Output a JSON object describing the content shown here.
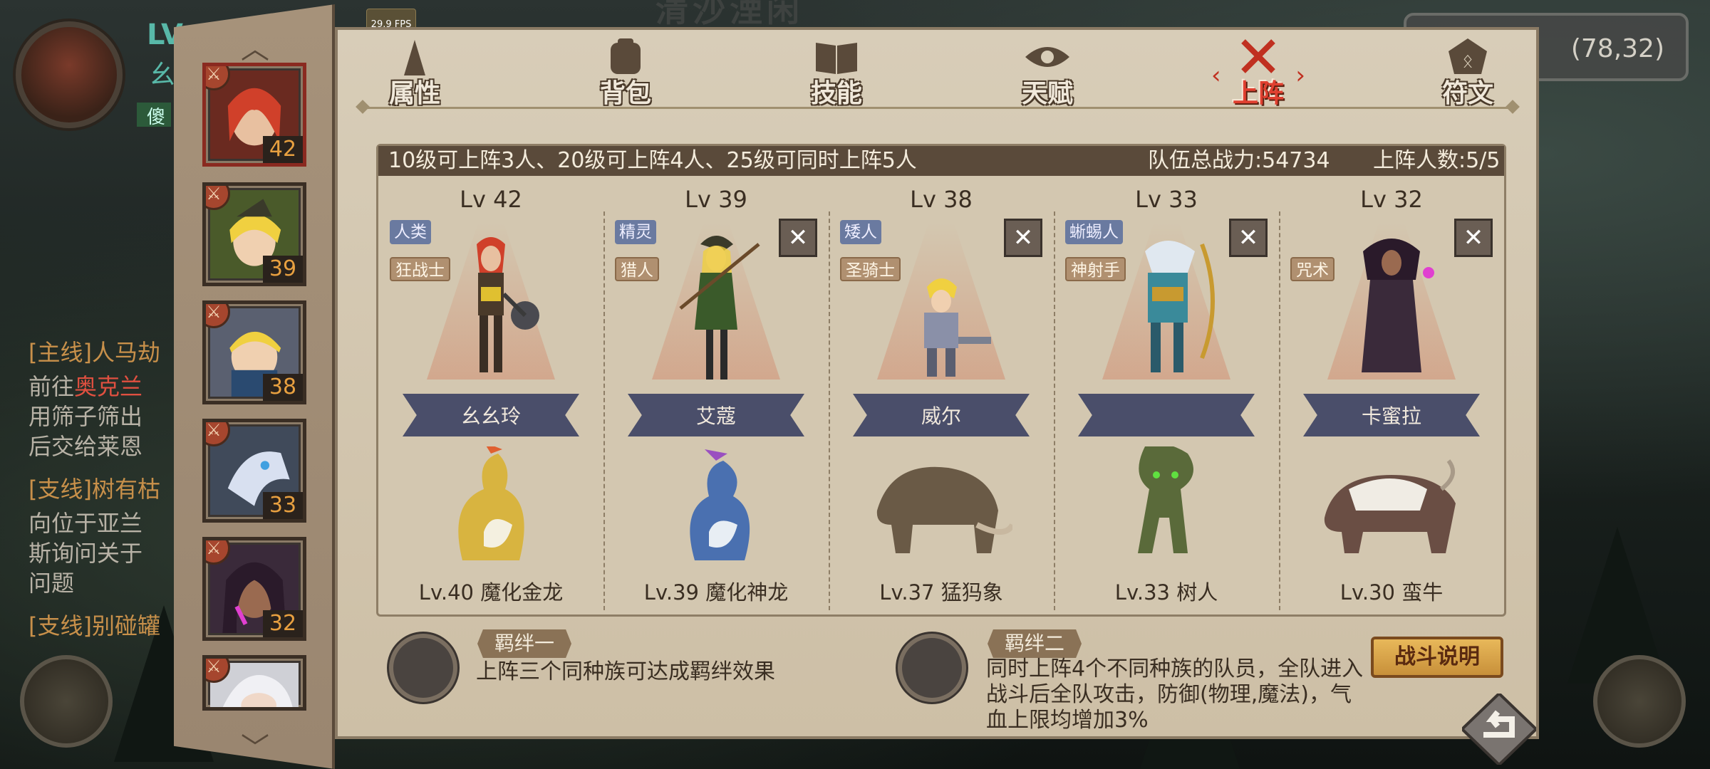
{
  "background": {
    "title": "清沙湮闲",
    "player": {
      "lv_prefix": "LV",
      "name_fragment": "幺",
      "status_fragment": "傻"
    },
    "coordinates": "(78,32)",
    "quests": [
      {
        "title": "[主线]人马劫",
        "lines": [
          "前往",
          "奥克兰",
          "用筛子筛出",
          "后交给莱恩"
        ]
      },
      {
        "title": "[支线]树有枯",
        "lines": [
          "向位于亚兰",
          "斯询问关于",
          "问题"
        ]
      },
      {
        "title": "[支线]别碰罐",
        "lines": []
      }
    ]
  },
  "fps": "29.9 FPS",
  "hero_column": {
    "levels": [
      "42",
      "39",
      "38",
      "33",
      "32",
      ""
    ]
  },
  "tabs": [
    {
      "label": "属性",
      "icon": "attribute-icon"
    },
    {
      "label": "背包",
      "icon": "backpack-icon"
    },
    {
      "label": "技能",
      "icon": "skill-book-icon"
    },
    {
      "label": "天赋",
      "icon": "talent-eye-icon"
    },
    {
      "label": "上阵",
      "icon": "crossed-swords-icon",
      "active": true
    },
    {
      "label": "符文",
      "icon": "rune-icon"
    }
  ],
  "lineup": {
    "rule": "10级可上阵3人、20级可上阵4人、25级可同时上阵5人",
    "power": "队伍总战力:54734",
    "count": "上阵人数:5/5",
    "members": [
      {
        "level": "Lv 42",
        "race": "人类",
        "class": "狂战士",
        "name": "幺幺玲",
        "pet": "Lv.40 魔化金龙",
        "removable": false
      },
      {
        "level": "Lv 39",
        "race": "精灵",
        "class": "猎人",
        "name": "艾蔻",
        "pet": "Lv.39 魔化神龙",
        "removable": true
      },
      {
        "level": "Lv 38",
        "race": "矮人",
        "class": "圣骑士",
        "name": "威尔",
        "pet": "Lv.37 猛犸象",
        "removable": true
      },
      {
        "level": "Lv 33",
        "race": "蜥蜴人",
        "class": "神射手",
        "name": "",
        "pet": "Lv.33 树人",
        "removable": true
      },
      {
        "level": "Lv 32",
        "race": "",
        "class": "咒术",
        "name": "卡蜜拉",
        "pet": "Lv.30 蛮牛",
        "removable": true
      }
    ],
    "remove_symbol": "✕"
  },
  "bonds": [
    {
      "title": "羁绊一",
      "desc": "上阵三个同种族可达成羁绊效果"
    },
    {
      "title": "羁绊二",
      "desc": "同时上阵4个不同种族的队员，全队进入战斗后全队攻击，防御(物理,魔法)，气血上限均增加3%"
    }
  ],
  "battle_button": "战斗说明",
  "colors": {
    "active_tab": "#e04030",
    "panel": "#d8cdb8",
    "header": "#5a4a3a",
    "level": "#e8a040"
  }
}
